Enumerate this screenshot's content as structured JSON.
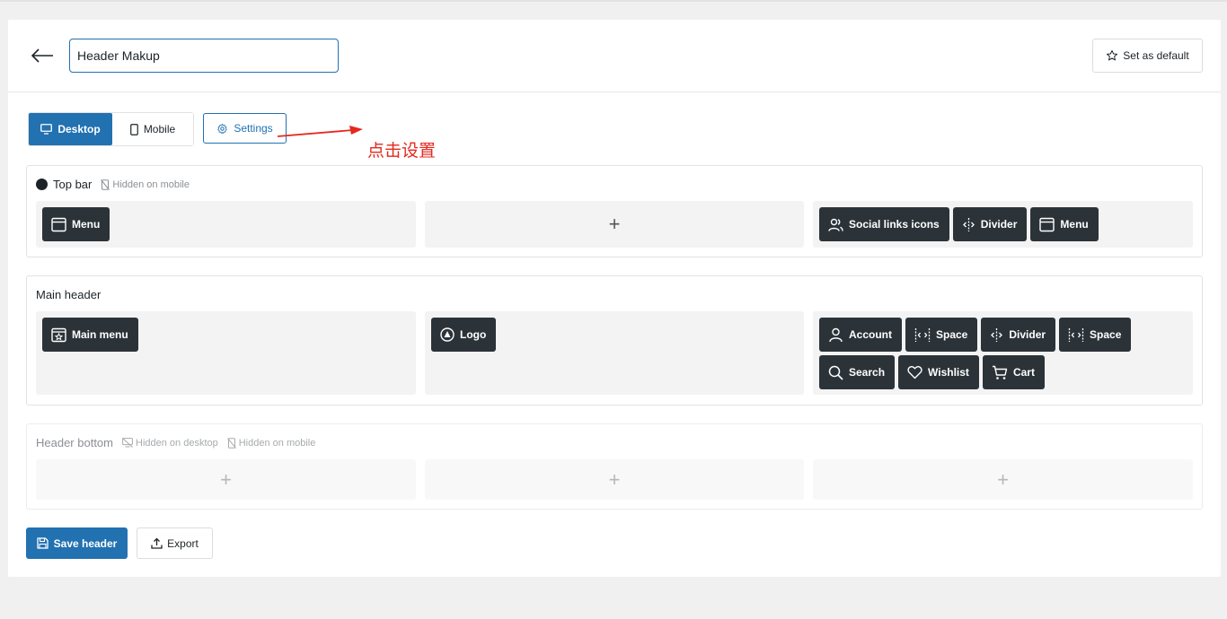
{
  "header": {
    "back_icon": "arrow-left-icon",
    "name_value": "Header Makup",
    "set_default_label": "Set as default",
    "set_default_icon": "star-icon"
  },
  "devices": {
    "desktop_label": "Desktop",
    "mobile_label": "Mobile",
    "settings_label": "Settings",
    "active": "Desktop"
  },
  "annotation": {
    "text": "点击设置",
    "color": "#e5271d"
  },
  "sections": {
    "top_bar": {
      "title": "Top bar",
      "tag_mobile": "Hidden on mobile",
      "left": [
        {
          "label": "Menu",
          "icon": "menu-window-icon"
        }
      ],
      "right": [
        {
          "label": "Social links icons",
          "icon": "users-icon"
        },
        {
          "label": "Divider",
          "icon": "divider-icon"
        },
        {
          "label": "Menu",
          "icon": "menu-window-icon"
        }
      ]
    },
    "main_header": {
      "title": "Main header",
      "left": [
        {
          "label": "Main menu",
          "icon": "main-menu-icon"
        }
      ],
      "center": [
        {
          "label": "Logo",
          "icon": "logo-icon"
        }
      ],
      "right": [
        {
          "label": "Account",
          "icon": "user-icon"
        },
        {
          "label": "Space",
          "icon": "space-icon"
        },
        {
          "label": "Divider",
          "icon": "divider-icon"
        },
        {
          "label": "Space",
          "icon": "space-icon"
        },
        {
          "label": "Search",
          "icon": "search-icon"
        },
        {
          "label": "Wishlist",
          "icon": "heart-icon"
        },
        {
          "label": "Cart",
          "icon": "cart-icon"
        }
      ]
    },
    "header_bottom": {
      "title": "Header bottom",
      "tag_desktop": "Hidden on desktop",
      "tag_mobile": "Hidden on mobile"
    }
  },
  "plus_symbol": "+",
  "footer": {
    "save_label": "Save header",
    "export_label": "Export"
  },
  "colors": {
    "accent": "#2271b1",
    "chip": "#2c3338"
  }
}
